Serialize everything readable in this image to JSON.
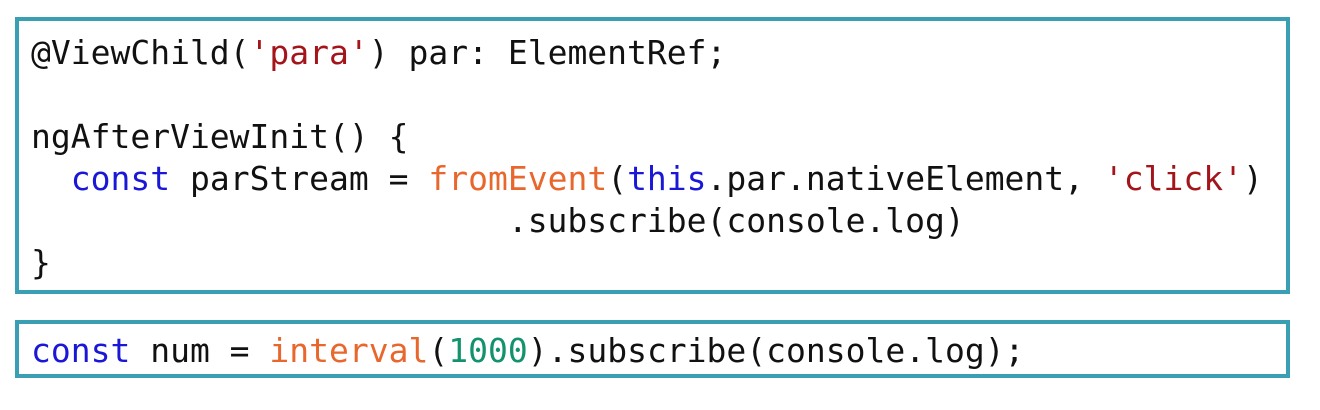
{
  "colors": {
    "panel_border": "#3a9fb3",
    "keyword": "#1a18d6",
    "function": "#e8672c",
    "string": "#a3151b",
    "number": "#13926e",
    "plain": "#111111"
  },
  "panel1": {
    "lines": [
      [
        {
          "t": "@ViewChild(",
          "c": "plain"
        },
        {
          "t": "'para'",
          "c": "string"
        },
        {
          "t": ") par: ElementRef;",
          "c": "plain"
        }
      ],
      [],
      [
        {
          "t": "ngAfterViewInit() {",
          "c": "plain"
        }
      ],
      [
        {
          "t": "  ",
          "c": "plain"
        },
        {
          "t": "const",
          "c": "keyword"
        },
        {
          "t": " parStream = ",
          "c": "plain"
        },
        {
          "t": "fromEvent",
          "c": "function"
        },
        {
          "t": "(",
          "c": "plain"
        },
        {
          "t": "this",
          "c": "keyword"
        },
        {
          "t": ".par.nativeElement, ",
          "c": "plain"
        },
        {
          "t": "'click'",
          "c": "string"
        },
        {
          "t": ")",
          "c": "plain"
        }
      ],
      [
        {
          "t": "                        .subscribe(console.log)",
          "c": "plain"
        }
      ],
      [
        {
          "t": "}",
          "c": "plain"
        }
      ]
    ]
  },
  "panel2": {
    "lines": [
      [
        {
          "t": "const",
          "c": "keyword"
        },
        {
          "t": " num = ",
          "c": "plain"
        },
        {
          "t": "interval",
          "c": "function"
        },
        {
          "t": "(",
          "c": "plain"
        },
        {
          "t": "1000",
          "c": "number"
        },
        {
          "t": ").subscribe(console.log);",
          "c": "plain"
        }
      ]
    ]
  }
}
